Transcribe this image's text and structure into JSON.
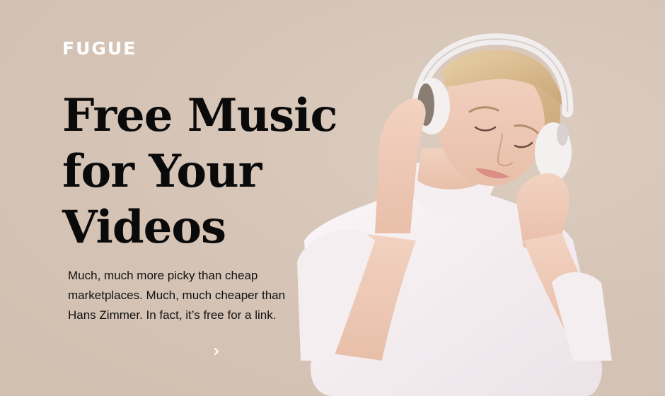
{
  "brand": {
    "logo_text": "FUGUE"
  },
  "hero": {
    "headline_lines": [
      "Free Music",
      "for Your",
      "Videos"
    ],
    "description_lines": [
      "Much, much more picky than cheap",
      "marketplaces. Much, much cheaper than",
      "Hans Zimmer. In fact, it’s free for a link."
    ],
    "next_icon": "chevron-right-icon"
  },
  "colors": {
    "background": "#d7c6b8",
    "headline": "#0b0a0a",
    "logo": "#ffffff"
  }
}
